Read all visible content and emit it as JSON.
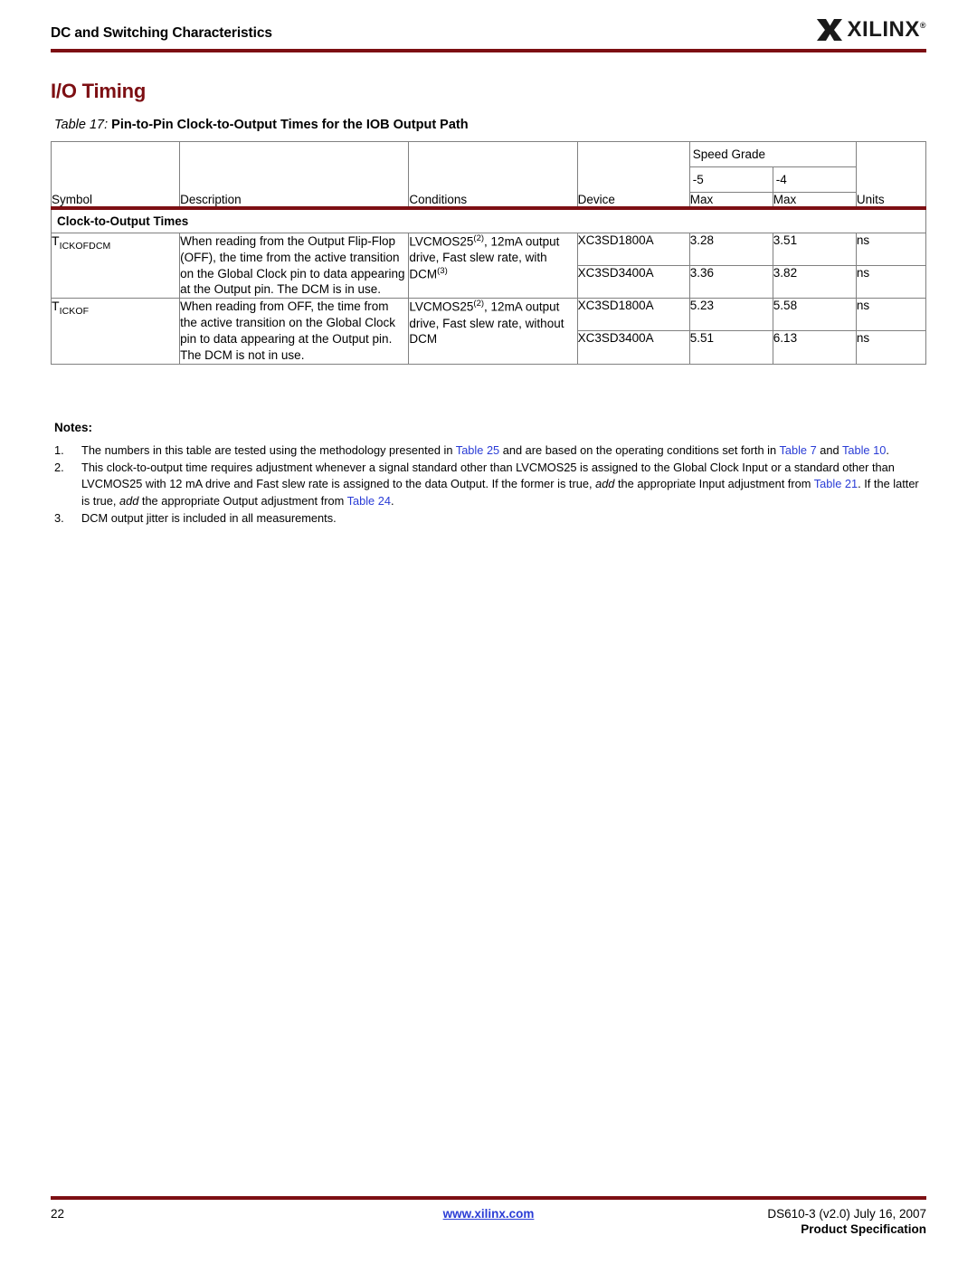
{
  "header": {
    "title": "DC and Switching Characteristics",
    "logo_text": "XILINX",
    "logo_registered": "®",
    "rule_color": "#7d0f13"
  },
  "section": {
    "title": "I/O Timing",
    "title_color": "#7d0f13"
  },
  "table": {
    "caption_label": "Table  17:",
    "caption_text": "Pin-to-Pin Clock-to-Output Times for the IOB Output Path",
    "columns": {
      "symbol": "Symbol",
      "description": "Description",
      "conditions": "Conditions",
      "device": "Device",
      "speed_grade": "Speed Grade",
      "grade_5": "-5",
      "grade_4": "-4",
      "max_5": "Max",
      "max_4": "Max",
      "units": "Units"
    },
    "section_row": "Clock-to-Output Times",
    "rows": [
      {
        "symbol_base": "T",
        "symbol_sub": "ICKOFDCM",
        "description": "When reading from the Output Flip-Flop (OFF), the time from the active transition on the Global Clock pin to data appearing at the Output pin. The DCM is in use.",
        "cond_pre": "LVCMOS25",
        "cond_sup1": "(2)",
        "cond_mid": ",   12mA output drive, Fast slew rate, with DCM",
        "cond_sup2": "(3)",
        "devices": [
          {
            "device": "XC3SD1800A",
            "max_5": "3.28",
            "max_4": "3.51",
            "units": "ns"
          },
          {
            "device": "XC3SD3400A",
            "max_5": "3.36",
            "max_4": "3.82",
            "units": "ns"
          }
        ]
      },
      {
        "symbol_base": "T",
        "symbol_sub": "ICKOF",
        "description": "When reading from OFF, the time from the active transition on the Global Clock pin to data appearing at the Output pin. The DCM is not in use.",
        "cond_pre": "LVCMOS25",
        "cond_sup1": "(2)",
        "cond_mid": ",   12mA output drive, Fast slew rate, without DCM",
        "cond_sup2": "",
        "devices": [
          {
            "device": "XC3SD1800A",
            "max_5": "5.23",
            "max_4": "5.58",
            "units": "ns"
          },
          {
            "device": "XC3SD3400A",
            "max_5": "5.51",
            "max_4": "6.13",
            "units": "ns"
          }
        ]
      }
    ]
  },
  "notes": {
    "title": "Notes:",
    "items": [
      {
        "num": "1.",
        "parts": [
          {
            "t": "The numbers in this table are tested using the methodology presented in ",
            "style": "plain"
          },
          {
            "t": "Table 25",
            "style": "link"
          },
          {
            "t": " and are based on the operating conditions set forth in ",
            "style": "plain"
          },
          {
            "t": "Table 7",
            "style": "link"
          },
          {
            "t": " and ",
            "style": "plain"
          },
          {
            "t": "Table 10",
            "style": "link"
          },
          {
            "t": ".",
            "style": "plain"
          }
        ]
      },
      {
        "num": "2.",
        "parts": [
          {
            "t": "This clock-to-output time requires adjustment whenever a signal standard other than LVCMOS25 is assigned to the Global Clock Input or a standard other than LVCMOS25 with 12 mA drive and Fast slew rate is assigned to the data Output. If the former is true, ",
            "style": "plain"
          },
          {
            "t": "add",
            "style": "italic"
          },
          {
            "t": " the appropriate Input adjustment from ",
            "style": "plain"
          },
          {
            "t": "Table 21",
            "style": "link"
          },
          {
            "t": ". If the latter is true, ",
            "style": "plain"
          },
          {
            "t": "add",
            "style": "italic"
          },
          {
            "t": " the appropriate Output adjustment from ",
            "style": "plain"
          },
          {
            "t": "Table 24",
            "style": "link"
          },
          {
            "t": ".",
            "style": "plain"
          }
        ]
      },
      {
        "num": "3.",
        "parts": [
          {
            "t": "DCM output jitter is included in all measurements.",
            "style": "plain"
          }
        ]
      }
    ]
  },
  "footer": {
    "page_number": "22",
    "url": "www.xilinx.com",
    "doc_id": "DS610-3 (v2.0) July 16, 2007",
    "spec_label": "Product Specification"
  }
}
